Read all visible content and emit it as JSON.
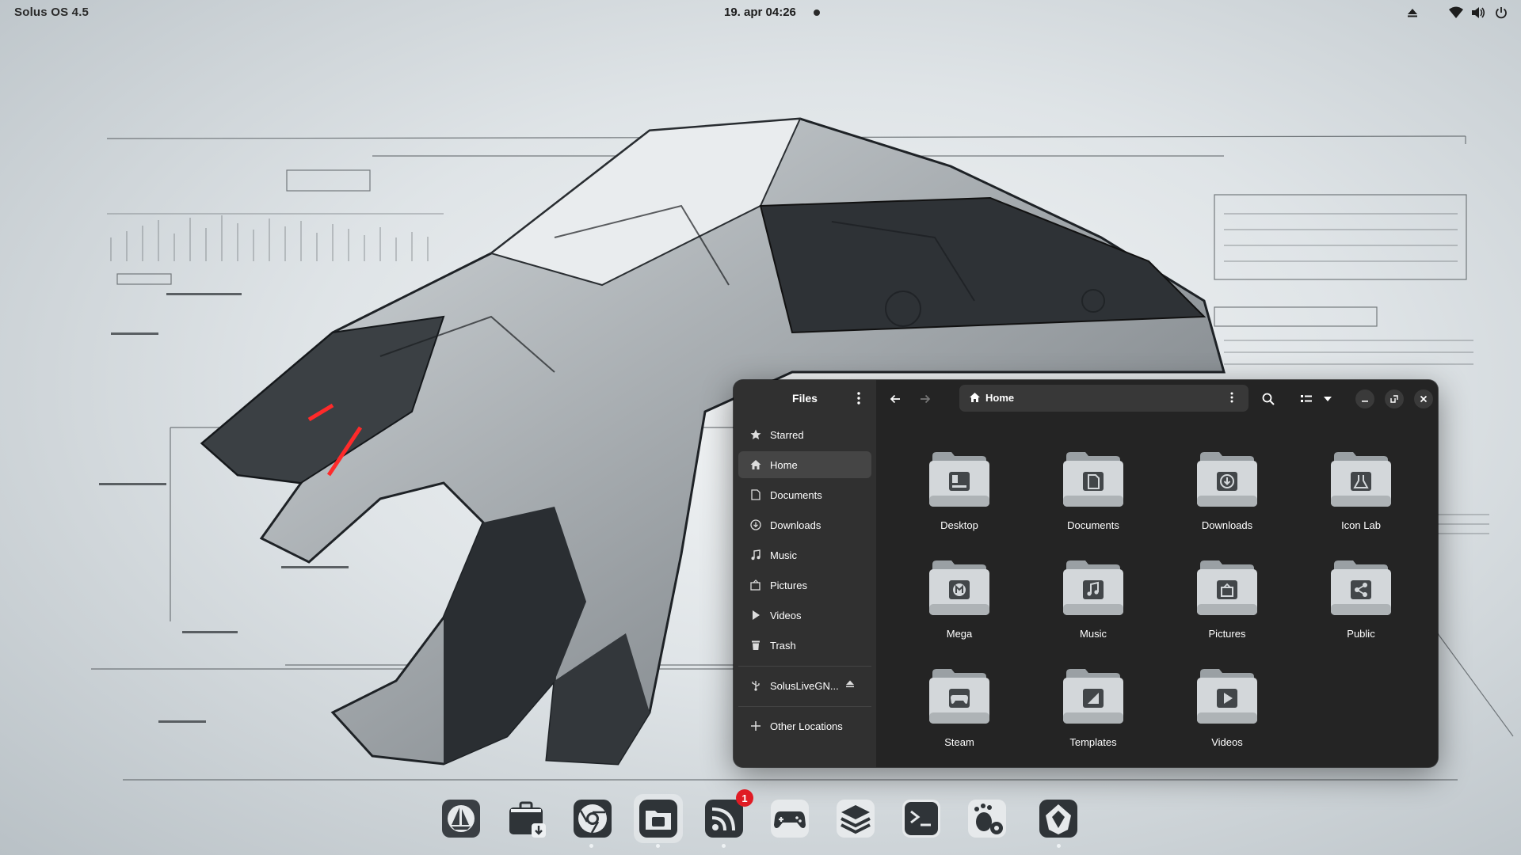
{
  "topbar": {
    "os_name": "Solus OS 4.5",
    "clock": "19. apr  04:26",
    "tray_icons": [
      "eject-icon",
      "wifi-icon",
      "volume-icon",
      "power-icon"
    ]
  },
  "window": {
    "sidebar_title": "Files",
    "path_label": "Home",
    "sidebar_items": [
      {
        "label": "Starred",
        "icon": "star-icon"
      },
      {
        "label": "Home",
        "icon": "home-icon",
        "active": true
      },
      {
        "label": "Documents",
        "icon": "document-icon"
      },
      {
        "label": "Downloads",
        "icon": "download-icon"
      },
      {
        "label": "Music",
        "icon": "music-note-icon"
      },
      {
        "label": "Pictures",
        "icon": "picture-icon"
      },
      {
        "label": "Videos",
        "icon": "play-icon"
      },
      {
        "label": "Trash",
        "icon": "trash-icon"
      }
    ],
    "drive_label": "SolusLiveGN...",
    "other_locations": "Other Locations",
    "folders": [
      {
        "label": "Desktop",
        "icon": "desktop-icon"
      },
      {
        "label": "Documents",
        "icon": "document-icon"
      },
      {
        "label": "Downloads",
        "icon": "download-icon"
      },
      {
        "label": "Icon Lab",
        "icon": "flask-icon"
      },
      {
        "label": "Mega",
        "icon": "mega-icon"
      },
      {
        "label": "Music",
        "icon": "music-note-icon"
      },
      {
        "label": "Pictures",
        "icon": "picture-icon"
      },
      {
        "label": "Public",
        "icon": "share-icon"
      },
      {
        "label": "Steam",
        "icon": "gamepad-icon"
      },
      {
        "label": "Templates",
        "icon": "template-icon"
      },
      {
        "label": "Videos",
        "icon": "play-icon"
      }
    ]
  },
  "dock": {
    "notification_badge": "1",
    "apps": [
      "solus-icon",
      "software-center-icon",
      "chrome-icon",
      "files-icon",
      "rss-reader-icon",
      "gamepad-icon",
      "layers-icon",
      "terminal-icon",
      "gnome-tweaks-icon",
      "app-icon"
    ]
  },
  "colors": {
    "window_bg": "#242424",
    "sidebar_bg": "#303030",
    "folder_body": "#d3d7da",
    "badge": "#e01b24"
  }
}
